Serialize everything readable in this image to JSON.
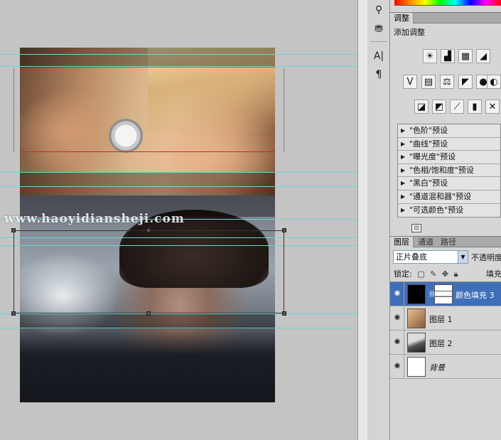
{
  "watermark": "www.haoyidiansheji.com",
  "canvas": {
    "top_image": "woman-with-watch-photo",
    "bottom_image": "man-portrait-photo"
  },
  "tool_strip": {
    "tools": [
      "usb-icon",
      "stamp-icon",
      "character-icon",
      "paragraph-icon"
    ],
    "labels": [
      "A|",
      "¶"
    ]
  },
  "adjustments": {
    "tab_label": "调整",
    "title": "添加调整",
    "icons_row1": [
      "brightness-icon",
      "levels-icon",
      "curves-icon",
      "exposure-icon"
    ],
    "icons_row2": [
      "vibrance-icon",
      "hue-saturation-icon",
      "color-balance-icon",
      "black-white-icon",
      "photo-filter-icon",
      "channel-mixer-icon"
    ],
    "icons_row3": [
      "invert-icon",
      "posterize-icon",
      "threshold-icon",
      "gradient-map-icon",
      "selective-color-icon"
    ],
    "glyph_row1": [
      "☀",
      "▟",
      "▦",
      "◢"
    ],
    "glyph_row2": [
      "V",
      "▤",
      "⚖",
      "◤",
      "●",
      "◐"
    ],
    "glyph_row3": [
      "◪",
      "◩",
      "⟋",
      "▮",
      "✕"
    ],
    "presets": [
      "\"色阶\"预设",
      "\"曲线\"预设",
      "\"曝光度\"预设",
      "\"色相/饱和度\"预设",
      "\"黑白\"预设",
      "\"通道混和器\"预设",
      "\"可选颜色\"预设"
    ],
    "footer_icon": "⊡"
  },
  "layers_panel": {
    "tabs": [
      "图层",
      "通道",
      "路径"
    ],
    "blend_mode": "正片叠底",
    "opacity_label": "不透明度",
    "lock_label": "锁定:",
    "fill_label": "填充",
    "layers": [
      {
        "name": "颜色填充 3",
        "selected": true
      },
      {
        "name": "图层 1",
        "selected": false
      },
      {
        "name": "图层 2",
        "selected": false
      },
      {
        "name": "背景",
        "selected": false
      }
    ]
  }
}
